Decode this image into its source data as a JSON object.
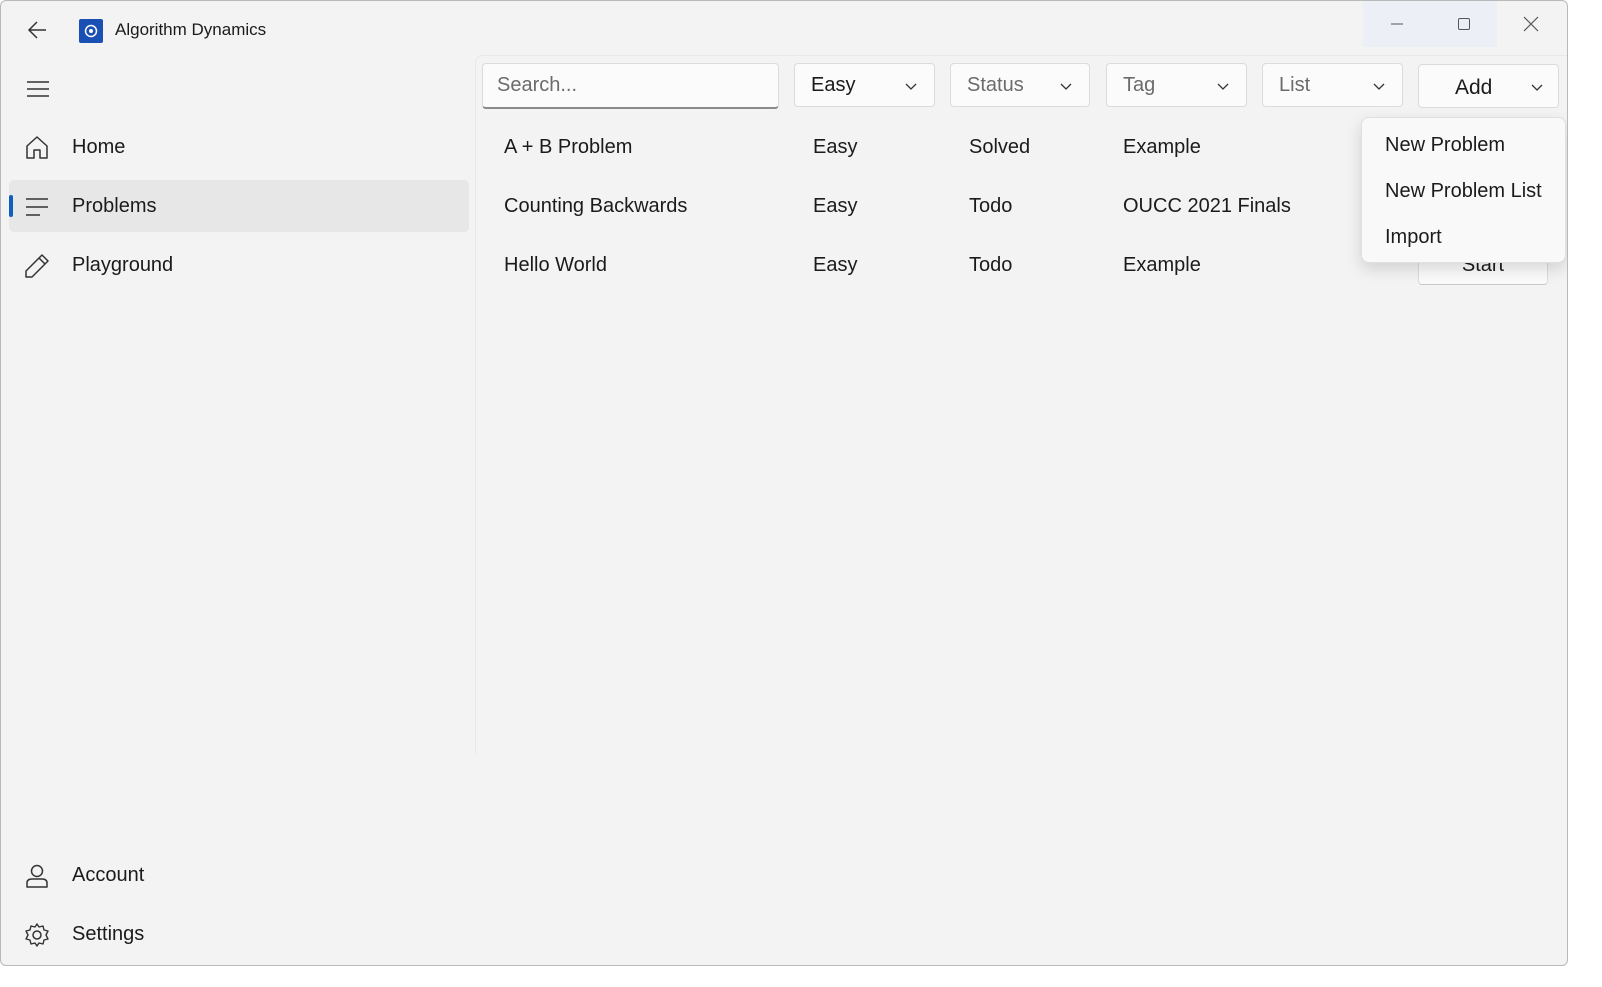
{
  "window": {
    "title": "Algorithm Dynamics",
    "icons": [
      "back-arrow-icon",
      "app-logo-icon",
      "minimize-icon",
      "maximize-icon",
      "close-icon"
    ]
  },
  "sidebar": {
    "top_items": [
      {
        "label": "Home",
        "icon": "home-icon"
      },
      {
        "label": "Problems",
        "icon": "list-icon",
        "selected": true
      },
      {
        "label": "Playground",
        "icon": "pencil-icon"
      }
    ],
    "bottom_items": [
      {
        "label": "Account",
        "icon": "person-icon"
      },
      {
        "label": "Settings",
        "icon": "gear-icon"
      }
    ]
  },
  "toolbar": {
    "search": {
      "placeholder": "Search...",
      "value": ""
    },
    "difficulty": {
      "value": "Easy"
    },
    "status": {
      "placeholder": "Status"
    },
    "tag": {
      "placeholder": "Tag"
    },
    "list": {
      "placeholder": "List"
    },
    "add_label": "Add"
  },
  "problems": [
    {
      "title": "A + B Problem",
      "difficulty": "Easy",
      "status": "Solved",
      "tag": "Example"
    },
    {
      "title": "Counting Backwards",
      "difficulty": "Easy",
      "status": "Todo",
      "tag": "OUCC 2021 Finals"
    },
    {
      "title": "Hello World",
      "difficulty": "Easy",
      "status": "Todo",
      "tag": "Example",
      "action": "Start"
    }
  ],
  "add_menu": {
    "items": [
      "New Problem",
      "New Problem List",
      "Import"
    ]
  },
  "colors": {
    "accent": "#0f5fbf",
    "app_icon": "#1a4fb3",
    "background": "#f3f3f3"
  }
}
